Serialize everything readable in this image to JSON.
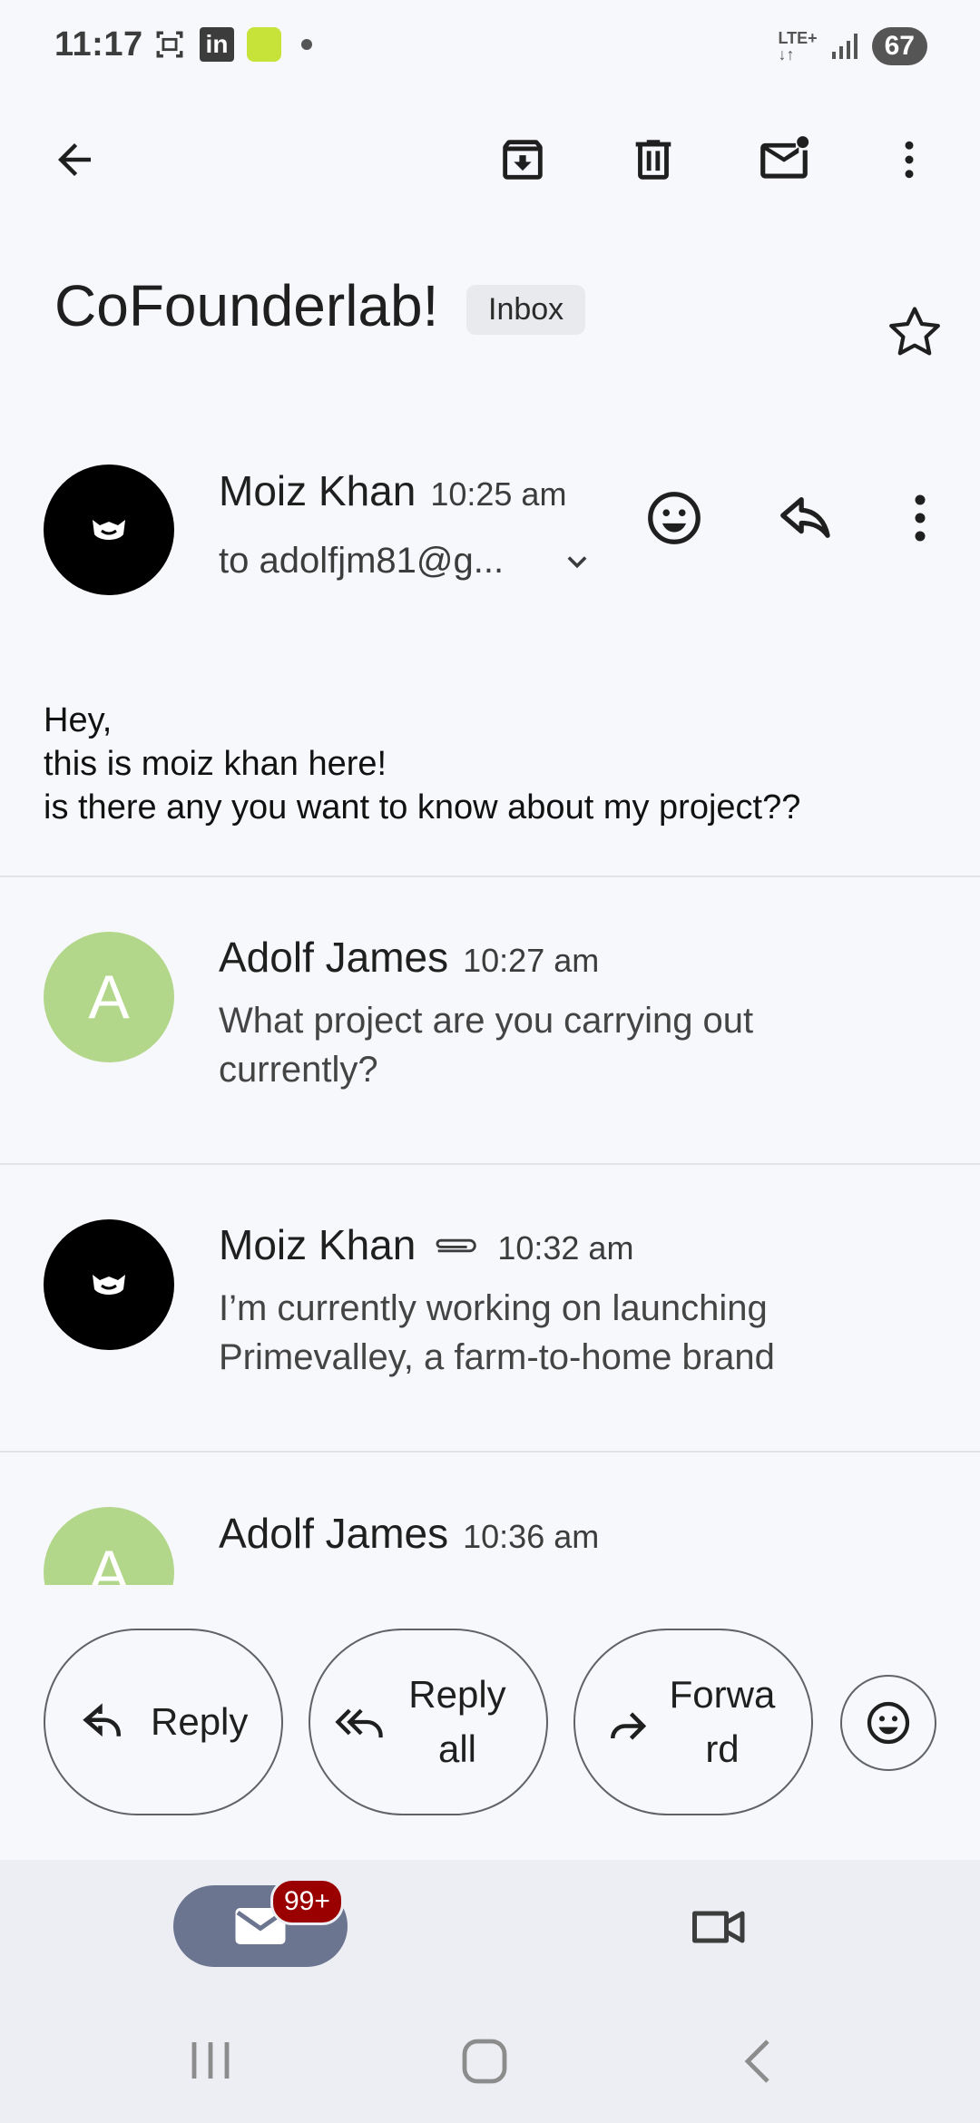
{
  "status_bar": {
    "time": "11:17",
    "linkedin_label": "in",
    "network_label": "LTE+",
    "battery": "67"
  },
  "toolbar": {
    "icons": [
      "back-arrow-icon",
      "archive-icon",
      "delete-icon",
      "mark-unread-icon",
      "more-vert-icon"
    ]
  },
  "thread": {
    "subject": "CoFounderlab!",
    "label": "Inbox"
  },
  "messages": [
    {
      "sender": "Moiz Khan",
      "time": "10:25 am",
      "recipient": "to adolfjm81@g...",
      "body": [
        "Hey,",
        "this is moiz khan here!",
        "is there any you want to know about my project??"
      ]
    },
    {
      "sender": "Adolf James",
      "initial": "A",
      "time": "10:27 am",
      "snippet": "What project are you carrying out currently?"
    },
    {
      "sender": "Moiz Khan",
      "time": "10:32 am",
      "has_attachment": true,
      "snippet": "I’m currently working on launching Primevalley, a farm-to-home brand"
    },
    {
      "sender": "Adolf James",
      "initial": "A",
      "time": "10:36 am"
    }
  ],
  "actions": {
    "reply": "Reply",
    "reply_all_line1": "Reply",
    "reply_all_line2": "all",
    "forward_line1": "Forwa",
    "forward_line2": "rd"
  },
  "bottom_nav": {
    "mail_badge": "99+"
  },
  "colors": {
    "background": "#f7f8fc",
    "avatar_green": "#b3d78a",
    "badge_red": "#9b0000",
    "nav_pill": "#6b7590"
  }
}
